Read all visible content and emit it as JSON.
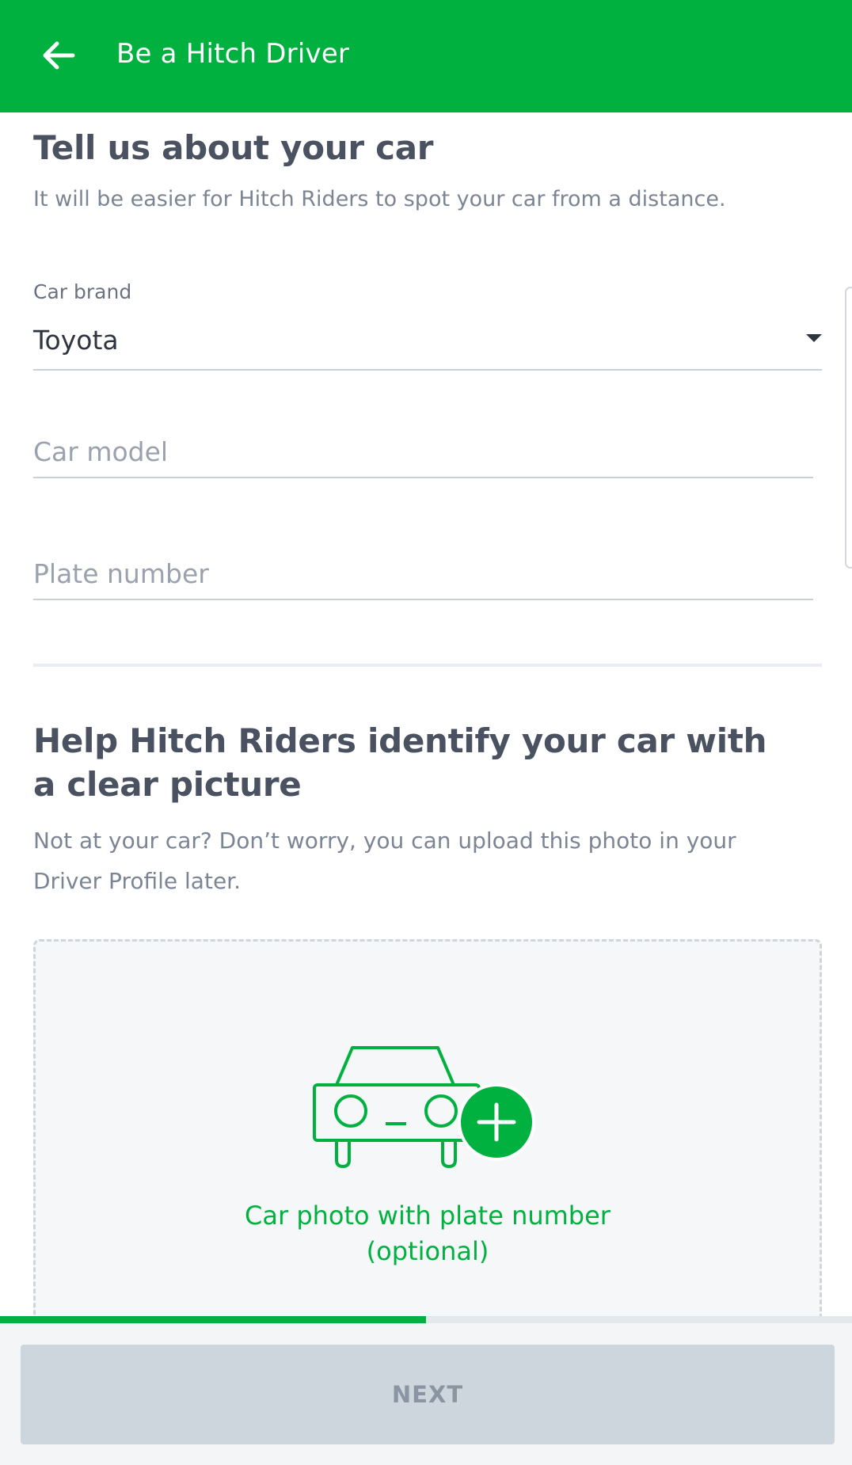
{
  "header": {
    "title": "Be a Hitch Driver"
  },
  "car_section": {
    "title": "Tell us about your car",
    "subtitle": "It will be easier for Hitch Riders to spot your car from a distance.",
    "brand_label": "Car brand",
    "brand_value": "Toyota",
    "model_placeholder": "Car model",
    "model_value": "",
    "plate_placeholder": "Plate number",
    "plate_value": ""
  },
  "photo_section": {
    "title": "Help Hitch Riders identify your car with a clear picture",
    "description": "Not at your car? Don’t worry, you can upload this photo in your Driver Profile later.",
    "upload_line1": "Car photo with plate number",
    "upload_line2": "(optional)"
  },
  "progress": {
    "fraction": 0.5
  },
  "footer": {
    "next_label": "NEXT"
  },
  "colors": {
    "brand_green": "#00b140",
    "disabled_button": "#cdd6dd"
  },
  "icons": {
    "back": "arrow-left-icon",
    "dropdown": "caret-down-icon",
    "car": "car-icon",
    "add": "plus-circle-icon"
  }
}
